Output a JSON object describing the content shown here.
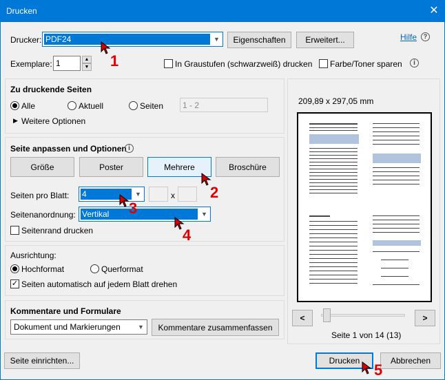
{
  "window": {
    "title": "Drucken",
    "close": "✕"
  },
  "printer": {
    "label": "Drucker:",
    "value": "PDF24",
    "props": "Eigenschaften",
    "advanced": "Erweitert...",
    "help": "Hilfe",
    "help_icon": "?"
  },
  "copies": {
    "label": "Exemplare:",
    "value": "1"
  },
  "options": {
    "grayscale": "In Graustufen (schwarzweiß) drucken",
    "toner": "Farbe/Toner sparen"
  },
  "pages": {
    "title": "Zu druckende Seiten",
    "all": "Alle",
    "current": "Aktuell",
    "pages": "Seiten",
    "range_placeholder": "1 - 2",
    "more": "Weitere Optionen"
  },
  "fit": {
    "title": "Seite anpassen und Optionen",
    "size": "Größe",
    "poster": "Poster",
    "multiple": "Mehrere",
    "booklet": "Broschüre",
    "ppsheet_label": "Seiten pro Blatt:",
    "ppsheet_value": "4",
    "x": "x",
    "order_label": "Seitenanordnung:",
    "order_value": "Vertikal",
    "border": "Seitenrand drucken"
  },
  "orientation": {
    "label": "Ausrichtung:",
    "portrait": "Hochformat",
    "landscape": "Querformat",
    "auto": "Seiten automatisch auf jedem Blatt drehen"
  },
  "comments": {
    "title": "Kommentare und Formulare",
    "value": "Dokument und Markierungen",
    "summarize": "Kommentare zusammenfassen"
  },
  "preview": {
    "size": "209,89 x 297,05 mm",
    "page": "Seite 1 von 14 (13)",
    "prev": "<",
    "next": ">"
  },
  "footer": {
    "setup": "Seite einrichten...",
    "print": "Drucken",
    "cancel": "Abbrechen"
  },
  "annotations": {
    "n1": "1",
    "n2": "2",
    "n3": "3",
    "n4": "4",
    "n5": "5"
  }
}
